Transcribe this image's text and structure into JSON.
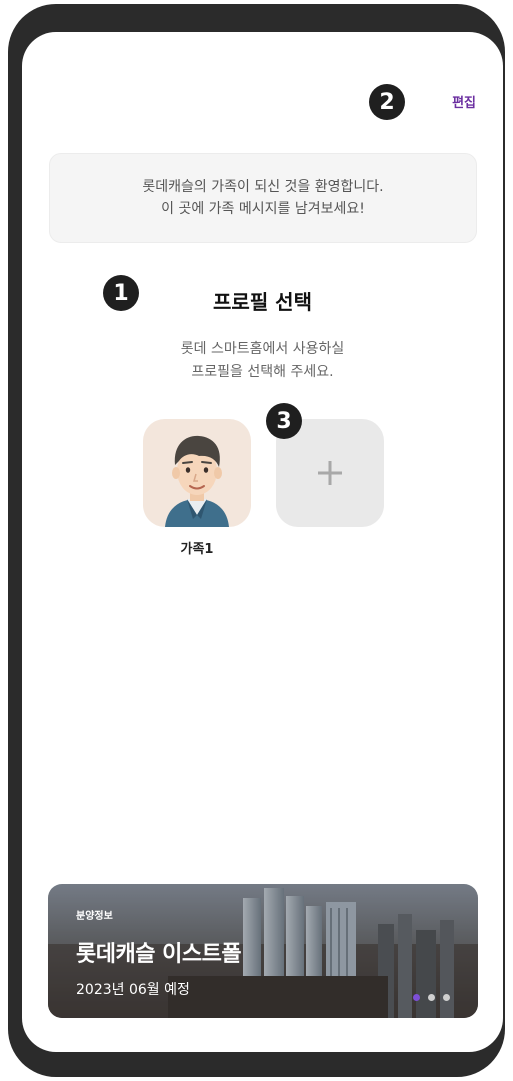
{
  "header": {
    "edit_label": "편집"
  },
  "badges": {
    "one": "1",
    "two": "2",
    "three": "3"
  },
  "welcome": {
    "line1": "롯데캐슬의 가족이 되신 것을 환영합니다.",
    "line2": "이 곳에 가족 메시지를 남겨보세요!"
  },
  "profile_select": {
    "title": "프로필 선택",
    "subtitle_line1": "롯데 스마트홈에서 사용하실",
    "subtitle_line2": "프로필을 선택해 주세요.",
    "profiles": [
      {
        "name": "가족1",
        "avatar": "man-avatar-icon"
      }
    ],
    "add_button_icon": "plus-icon"
  },
  "banner": {
    "kicker": "분양정보",
    "title": "롯데캐슬 이스트폴",
    "date": "2023년 06월 예정",
    "page_count": 3,
    "active_page": 1
  },
  "colors": {
    "accent": "#6b2fa0",
    "active_dot": "#7d4fd6",
    "badge": "#1f1f1f",
    "avatar_bg": "#f3e6dc"
  }
}
